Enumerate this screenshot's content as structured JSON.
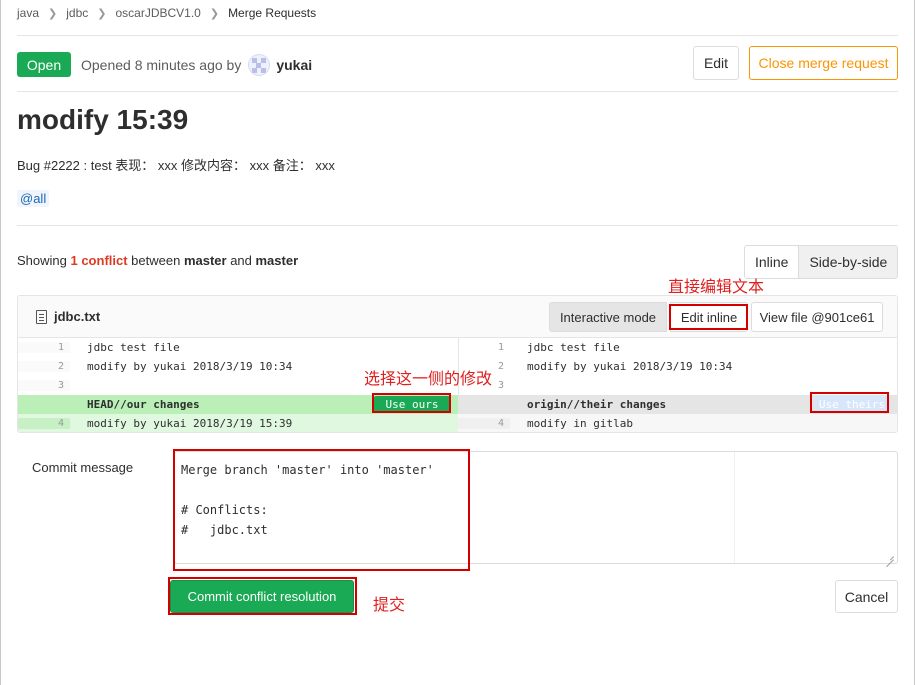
{
  "breadcrumb": [
    "java",
    "jdbc",
    "oscarJDBCV1.0",
    "Merge Requests"
  ],
  "status": "Open",
  "opened_text": "Opened 8 minutes ago by",
  "author": "yukai",
  "buttons": {
    "edit": "Edit",
    "close": "Close merge request"
  },
  "title": "modify 15:39",
  "description": "Bug #2222 : test 表现： xxx 修改内容： xxx 备注： xxx",
  "mention": "@all",
  "conflict_summary": {
    "prefix": "Showing ",
    "count": "1 conflict",
    "between": " between ",
    "source": "master",
    "and": " and ",
    "target": "master"
  },
  "view_modes": [
    "Inline",
    "Side-by-side"
  ],
  "file": {
    "name": "jdbc.txt",
    "interactive_mode": "Interactive mode",
    "edit_inline": "Edit inline",
    "view_file": "View file @901ce61"
  },
  "diff": {
    "left": [
      {
        "ln": "1",
        "text": "jdbc test file"
      },
      {
        "ln": "2",
        "text": "modify by yukai 2018/3/19 10:34"
      },
      {
        "ln": "3",
        "text": ""
      },
      {
        "ln": "",
        "text": "HEAD//our changes"
      },
      {
        "ln": "4",
        "text": "modify by yukai 2018/3/19 15:39"
      }
    ],
    "right": [
      {
        "ln": "1",
        "text": "jdbc test file"
      },
      {
        "ln": "2",
        "text": "modify by yukai 2018/3/19 10:34"
      },
      {
        "ln": "3",
        "text": ""
      },
      {
        "ln": "",
        "text": "origin//their changes"
      },
      {
        "ln": "4",
        "text": "modify in gitlab"
      }
    ],
    "use_ours": "Use ours",
    "use_theirs": "Use theirs"
  },
  "commit": {
    "label": "Commit message",
    "message": "Merge branch 'master' into 'master'\n\n# Conflicts:\n#   jdbc.txt",
    "submit": "Commit conflict resolution",
    "cancel": "Cancel"
  },
  "annotations": {
    "edit_text": "直接编辑文本",
    "choose_side": "选择这一侧的修改",
    "submit": "提交"
  },
  "colors": {
    "green": "#1aaa55",
    "orange": "#fc9403",
    "red_annotation": "#e02020",
    "conflict_red": "#db3b21"
  }
}
